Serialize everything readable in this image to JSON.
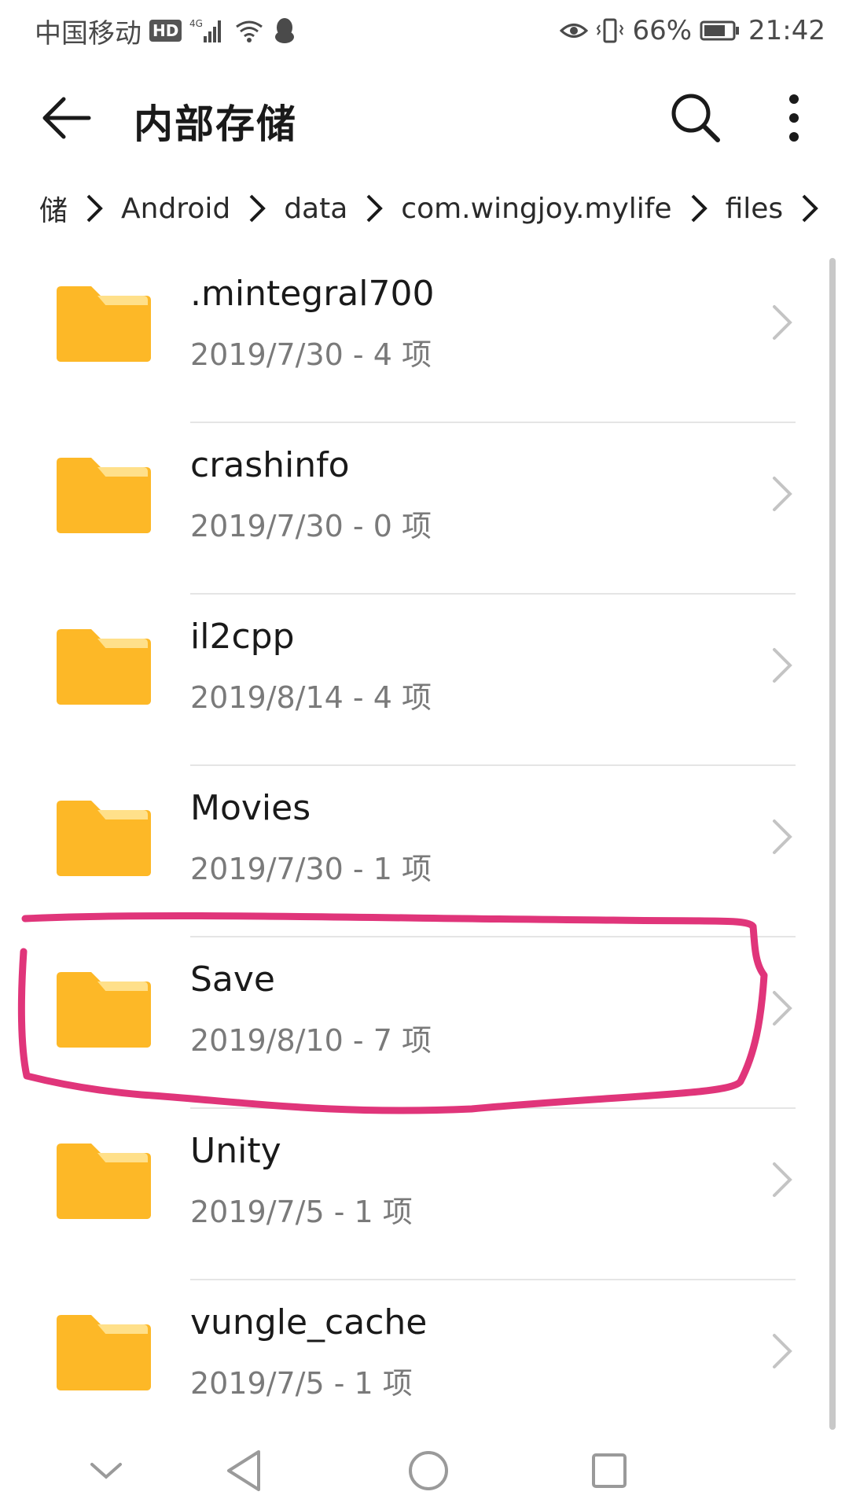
{
  "status_bar": {
    "carrier": "中国移动",
    "hd_badge": "HD",
    "network": "4G",
    "battery_percent": "66%",
    "time": "21:42"
  },
  "app_bar": {
    "title": "内部存储"
  },
  "breadcrumb": {
    "items": [
      "储",
      "Android",
      "data",
      "com.wingjoy.mylife",
      "files"
    ]
  },
  "files": [
    {
      "name": ".mintegral700",
      "meta": "2019/7/30 - 4 项"
    },
    {
      "name": "crashinfo",
      "meta": "2019/7/30 - 0 项"
    },
    {
      "name": "il2cpp",
      "meta": "2019/8/14 - 4 项"
    },
    {
      "name": "Movies",
      "meta": "2019/7/30 - 1 项"
    },
    {
      "name": "Save",
      "meta": "2019/8/10 - 7 项"
    },
    {
      "name": "Unity",
      "meta": "2019/7/5 - 1 项"
    },
    {
      "name": "vungle_cache",
      "meta": "2019/7/5 - 1 项"
    }
  ],
  "colors": {
    "folder_main": "#FDB827",
    "folder_tab": "#FFE08A",
    "highlight": "#E0357A"
  },
  "icons": {
    "back": "arrow-left-icon",
    "search": "search-icon",
    "more": "more-vertical-icon",
    "folder": "folder-icon",
    "chevron": "chevron-right-icon"
  }
}
